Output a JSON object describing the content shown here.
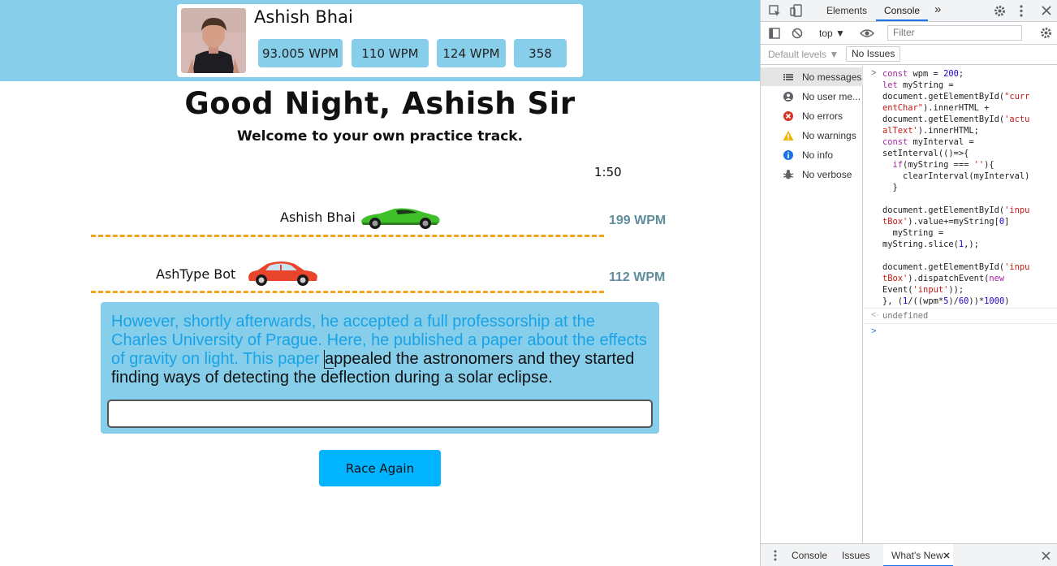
{
  "profile": {
    "name": "Ashish Bhai",
    "stats": [
      "93.005 WPM",
      "110 WPM",
      "124 WPM",
      "358"
    ]
  },
  "greeting": "Good Night, Ashish Sir",
  "welcome": "Welcome to your own practice track.",
  "timer": "1:50",
  "racers": [
    {
      "name": "Ashish Bhai",
      "wpm": "199 WPM",
      "car_color": "#3fbf2a"
    },
    {
      "name": "AshType Bot",
      "wpm": "112 WPM",
      "car_color": "#e8452c"
    }
  ],
  "passage": {
    "typed": "However, shortly afterwards, he accepted a full professorship at the Charles University of Prague. Here, he published a paper about the effects of gravity on light. This paper ",
    "current_char": "a",
    "remaining": "ppealed the astronomers and they started finding ways of detecting the deflection during a solar eclipse."
  },
  "input": {
    "value": ""
  },
  "race_again_label": "Race Again",
  "colors": {
    "accent": "#87ceeb",
    "button": "#00b4ff",
    "typed": "#19a3e6",
    "track": "#f2a41c"
  },
  "devtools": {
    "tabs": {
      "elements": "Elements",
      "console": "Console",
      "more": "»"
    },
    "context": "top ▼",
    "filter_placeholder": "Filter",
    "levels": "Default levels ▼",
    "issues": "No Issues",
    "sidebar": [
      {
        "label": "No messages",
        "icon": "list-icon"
      },
      {
        "label": "No user me...",
        "icon": "user-icon"
      },
      {
        "label": "No errors",
        "icon": "error-icon"
      },
      {
        "label": "No warnings",
        "icon": "warning-icon"
      },
      {
        "label": "No info",
        "icon": "info-icon"
      },
      {
        "label": "No verbose",
        "icon": "bug-icon"
      }
    ],
    "result": "undefined",
    "drawer_tabs": {
      "console": "Console",
      "issues": "Issues",
      "whats_new": "What's New"
    }
  }
}
